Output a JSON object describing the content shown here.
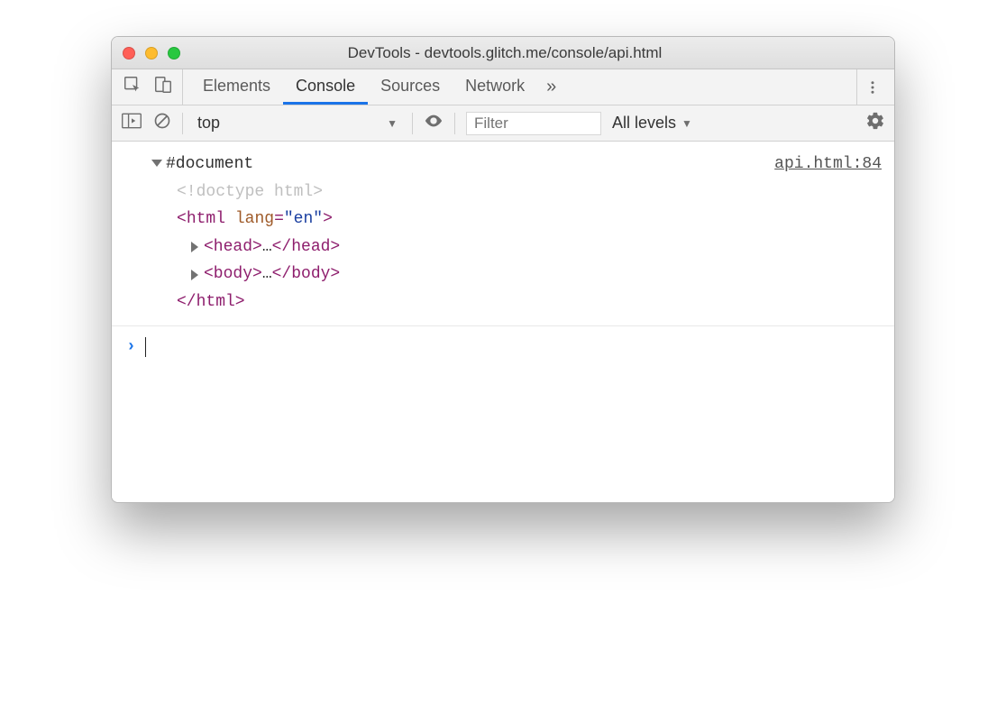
{
  "window": {
    "title": "DevTools - devtools.glitch.me/console/api.html"
  },
  "tabs": {
    "elements": "Elements",
    "console": "Console",
    "sources": "Sources",
    "network": "Network",
    "more": "»"
  },
  "toolbar": {
    "context": "top",
    "filter_placeholder": "Filter",
    "levels": "All levels"
  },
  "log": {
    "source": "api.html:84",
    "document_label": "#document",
    "doctype": "<!doctype html>",
    "html_open_prefix": "<",
    "html_tag": "html",
    "html_attr_name": "lang",
    "html_attr_eq": "=",
    "html_attr_val": "\"en\"",
    "html_open_suffix": ">",
    "head_open": "<head>",
    "head_ellipsis": "…",
    "head_close": "</head>",
    "body_open": "<body>",
    "body_ellipsis": "…",
    "body_close": "</body>",
    "html_close": "</html>"
  },
  "prompt": {
    "chevron": "›"
  }
}
